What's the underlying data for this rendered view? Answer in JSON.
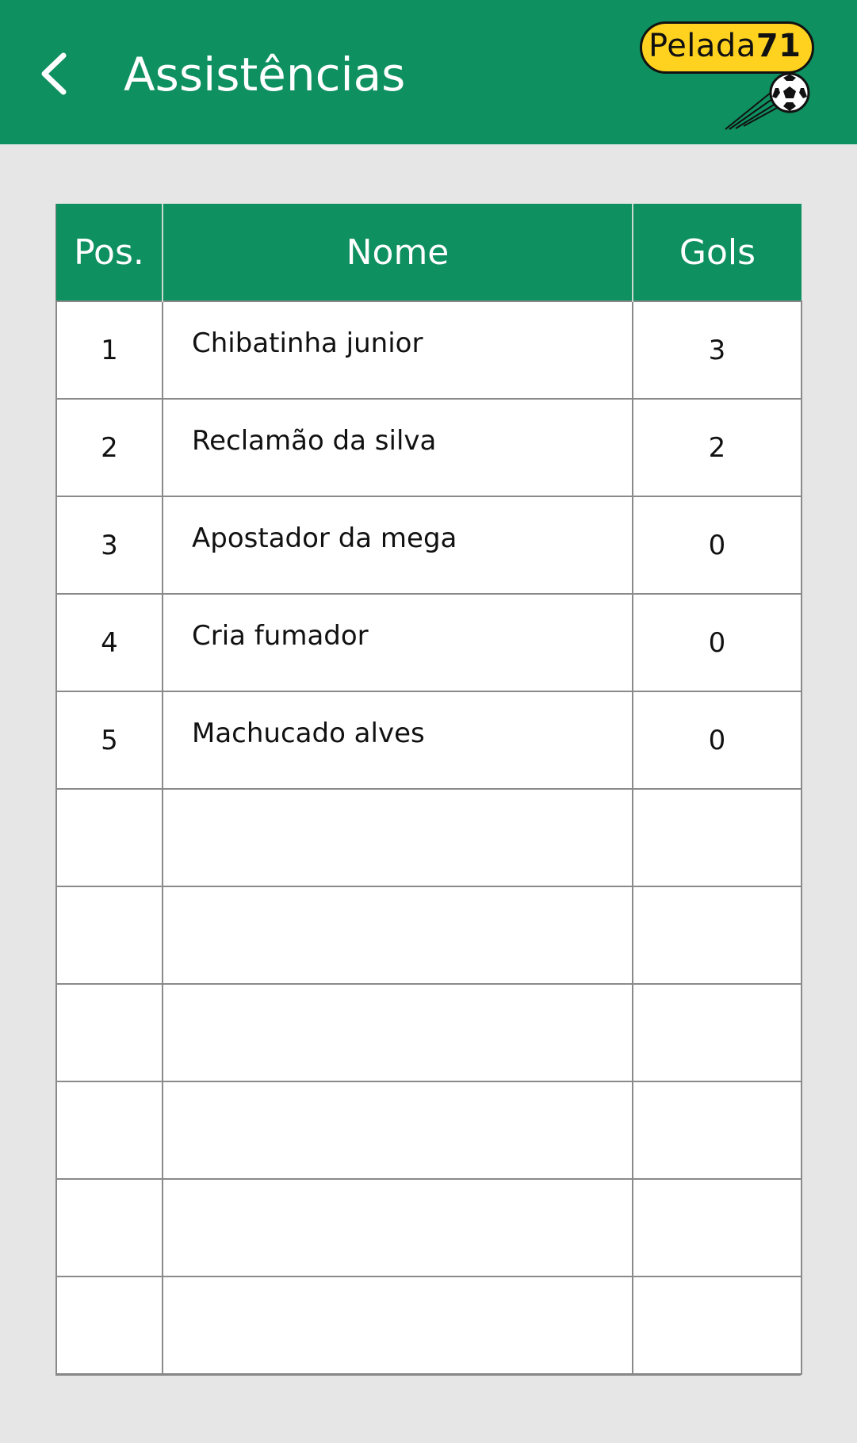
{
  "header": {
    "title": "Assistências",
    "logo_text": "Pelada",
    "logo_number": "71",
    "colors": {
      "bar": "#0e9060",
      "logo_fill": "#ffd21f"
    }
  },
  "table": {
    "columns": [
      "Pos.",
      "Nome",
      "Gols"
    ],
    "rows": [
      {
        "pos": "1",
        "nome": "Chibatinha junior",
        "gols": "3"
      },
      {
        "pos": "2",
        "nome": "Reclamão da silva",
        "gols": "2"
      },
      {
        "pos": "3",
        "nome": "Apostador da mega",
        "gols": "0"
      },
      {
        "pos": "4",
        "nome": "Cria fumador",
        "gols": "0"
      },
      {
        "pos": "5",
        "nome": "Machucado alves",
        "gols": "0"
      },
      {
        "pos": "",
        "nome": "",
        "gols": ""
      },
      {
        "pos": "",
        "nome": "",
        "gols": ""
      },
      {
        "pos": "",
        "nome": "",
        "gols": ""
      },
      {
        "pos": "",
        "nome": "",
        "gols": ""
      },
      {
        "pos": "",
        "nome": "",
        "gols": ""
      },
      {
        "pos": "",
        "nome": "",
        "gols": ""
      }
    ]
  },
  "icons": {
    "back": "chevron-left-icon",
    "ball": "soccer-ball-icon"
  }
}
